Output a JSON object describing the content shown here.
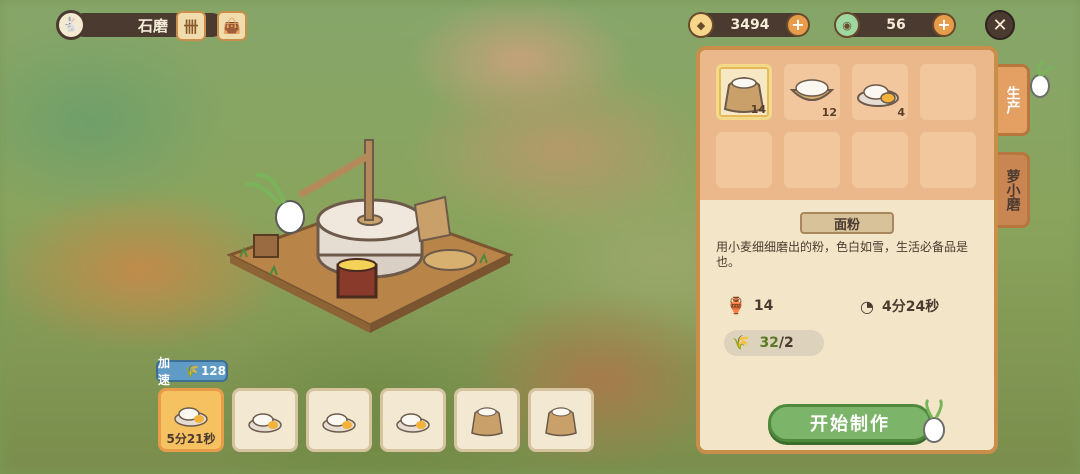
{
  "header": {
    "title": "石磨",
    "badge_icon": "rabbit-icon",
    "book_icon": "scroll-icon",
    "bag_icon": "bag-icon"
  },
  "currency": {
    "coins": "3494",
    "gems": "56"
  },
  "recipe_grid": {
    "items": [
      {
        "name": "flour-bag",
        "count": "14",
        "selected": true
      },
      {
        "name": "flour-bowl",
        "count": "12",
        "selected": false
      },
      {
        "name": "flour-plate-egg",
        "count": "4",
        "selected": false
      }
    ]
  },
  "detail": {
    "name": "面粉",
    "description": "用小麦细细磨出的粉，色白如雪，生活必备品是也。",
    "owned": "14",
    "duration": "4分24秒",
    "req_have": "32",
    "req_need": "/2",
    "start_label": "开始制作"
  },
  "tabs": [
    "生产",
    "萝小磨"
  ],
  "queue": {
    "speedup_label": "加速",
    "speedup_value": "128",
    "active_time": "5分21秒",
    "slot_count": 6
  },
  "colors": {
    "panel_border": "#c98e4a",
    "start_button": "#7cb56a",
    "active_slot": "#f6c160"
  }
}
